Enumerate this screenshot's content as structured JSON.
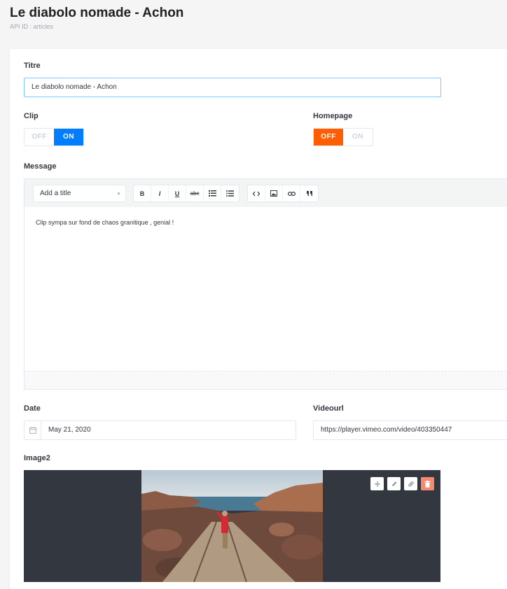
{
  "header": {
    "title": "Le diabolo nomade - Achon",
    "subtitle": "API ID : articles"
  },
  "fields": {
    "titre": {
      "label": "Titre",
      "value": "Le diabolo nomade - Achon"
    },
    "clip": {
      "label": "Clip",
      "off": "OFF",
      "on": "ON",
      "value": "ON"
    },
    "homepage": {
      "label": "Homepage",
      "off": "OFF",
      "on": "ON",
      "value": "OFF"
    },
    "message": {
      "label": "Message",
      "select_value": "Add a title",
      "content": "Clip sympa sur fond de chaos granitique , genial !",
      "toolbar": [
        "B",
        "I",
        "U",
        "abc",
        "ordered-list",
        "bullet-list",
        "code",
        "image",
        "link",
        "quote"
      ]
    },
    "date": {
      "label": "Date",
      "value": "May 21, 2020"
    },
    "videourl": {
      "label": "Videourl",
      "value": "https://player.vimeo.com/video/403350447"
    },
    "image2": {
      "label": "Image2",
      "actions": [
        "add-icon",
        "edit-icon",
        "link-icon",
        "delete-icon"
      ]
    }
  },
  "colors": {
    "primary": "#007eff",
    "danger": "#ff5d00",
    "delete": "#f38a6d",
    "dark": "#333740"
  }
}
